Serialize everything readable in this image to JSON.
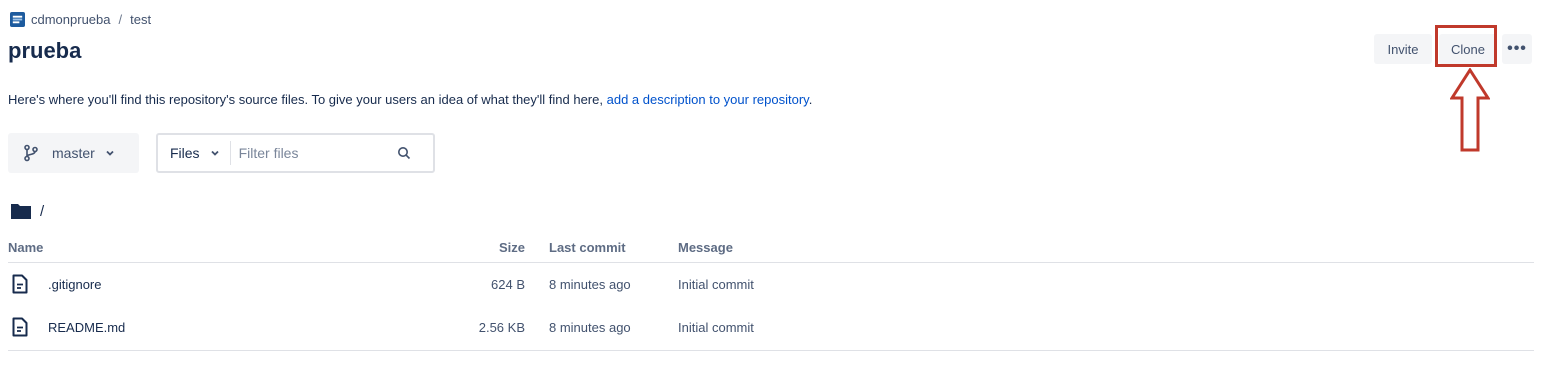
{
  "breadcrumb": {
    "project": "cdmonprueba",
    "separator": "/",
    "repo": "test"
  },
  "repo_title": "prueba",
  "header_buttons": {
    "invite": "Invite",
    "clone": "Clone",
    "more": "•••"
  },
  "description": {
    "text": "Here's where you'll find this repository's source files. To give your users an idea of what they'll find here,",
    "link": "add a description to your repository",
    "end": "."
  },
  "branch": {
    "name": "master",
    "icon": "branch-icon"
  },
  "filter": {
    "type_label": "Files",
    "placeholder": "Filter files",
    "value": ""
  },
  "path": {
    "label": "/",
    "icon": "folder-icon"
  },
  "table": {
    "headers": {
      "name": "Name",
      "size": "Size",
      "last_commit": "Last commit",
      "message": "Message"
    },
    "rows": [
      {
        "name": ".gitignore",
        "size": "624 B",
        "last_commit": "8 minutes ago",
        "message": "Initial commit"
      },
      {
        "name": "README.md",
        "size": "2.56 KB",
        "last_commit": "8 minutes ago",
        "message": "Initial commit"
      }
    ]
  },
  "colors": {
    "annotation": "#c0392b",
    "link": "#0052cc",
    "title": "#172b4d"
  }
}
